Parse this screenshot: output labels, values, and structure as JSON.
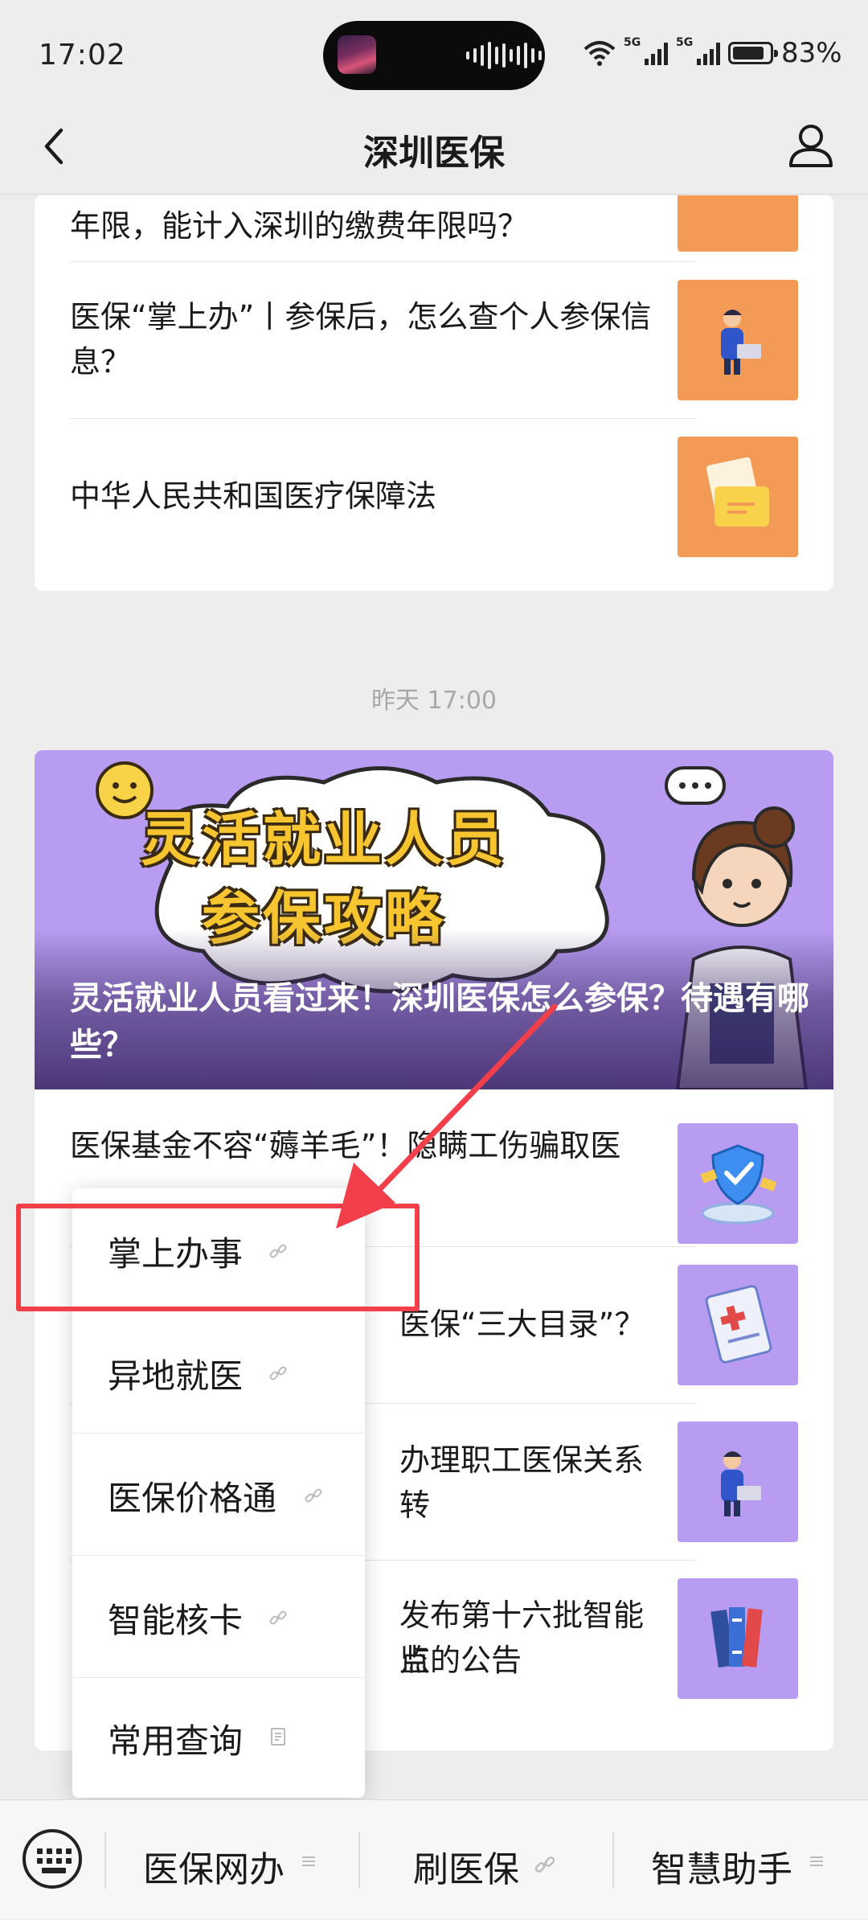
{
  "status_bar": {
    "time": "17:02",
    "battery": "83%",
    "network_1": "5G",
    "network_2": "5G"
  },
  "navbar": {
    "title": "深圳医保"
  },
  "first_card": {
    "rows": [
      {
        "title": "年限，能计入深圳的缴费年限吗？"
      },
      {
        "title": "医保“掌上办”丨参保后，怎么查个人参保信息？"
      },
      {
        "title": "中华人民共和国医疗保障法"
      }
    ]
  },
  "timestamp": "昨天 17:00",
  "second_card": {
    "hero": {
      "image_text_line1": "灵活就业人员",
      "image_text_line2": "参保攻略",
      "caption": "灵活就业人员看过来！深圳医保怎么参保？待遇有哪些？"
    },
    "rows": [
      {
        "title": "医保基金不容“薅羊毛”！隐瞒工伤骗取医"
      },
      {
        "title": "医保“三大目录”？"
      },
      {
        "title": "办理职工医保关系转"
      },
      {
        "title_line1": "发布第十六批智能监",
        "title_line2": "点的公告"
      }
    ]
  },
  "popup_menu": {
    "items": [
      {
        "label": "掌上办事",
        "icon": "link-icon"
      },
      {
        "label": "异地就医",
        "icon": "link-icon"
      },
      {
        "label": "医保价格通",
        "icon": "link-icon"
      },
      {
        "label": "智能核卡",
        "icon": "link-icon"
      },
      {
        "label": "常用查询",
        "icon": "article-icon"
      }
    ]
  },
  "bottom_menu": {
    "items": [
      {
        "label": "医保网办",
        "icon": "submenu-icon"
      },
      {
        "label": "刷医保",
        "icon": "link-icon"
      },
      {
        "label": "智慧助手",
        "icon": "submenu-icon"
      }
    ]
  },
  "colors": {
    "thumb_orange": "#f29a56",
    "thumb_purple": "#b79cf1",
    "highlight_red": "#f23f4a"
  }
}
